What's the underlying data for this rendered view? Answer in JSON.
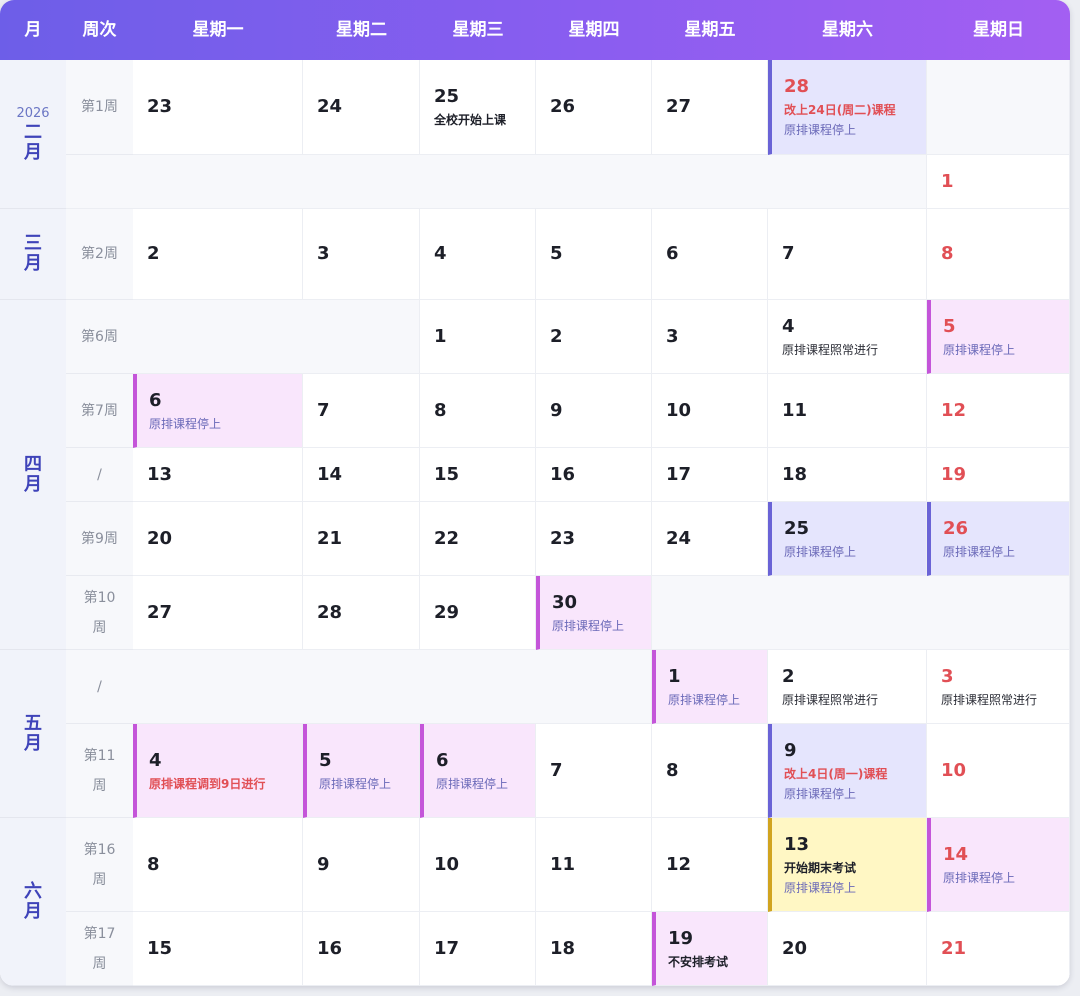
{
  "header": [
    "月",
    "周次",
    "星期一",
    "星期二",
    "星期三",
    "星期四",
    "星期五",
    "星期六",
    "星期日"
  ],
  "months": [
    {
      "name": "二月",
      "year": "2026"
    },
    {
      "name": "三月"
    },
    {
      "name": "四月"
    },
    {
      "name": "五月"
    },
    {
      "name": "六月"
    }
  ],
  "weeks": [
    "第1周",
    "第2周",
    "第6周",
    "第7周",
    "/",
    "第9周",
    "第10周",
    "/",
    "第11周",
    "第16周",
    "第17周"
  ],
  "days": [
    {
      "d": "23"
    },
    {
      "d": "24"
    },
    {
      "d": "25",
      "notes": [
        "全校开始上课"
      ]
    },
    {
      "d": "26"
    },
    {
      "d": "27"
    },
    {
      "d": "28",
      "notes": [
        "改上24日(周二)课程",
        "原排课程停上"
      ]
    },
    {
      "d": "1"
    },
    {
      "d": "2"
    },
    {
      "d": "3"
    },
    {
      "d": "4"
    },
    {
      "d": "5"
    },
    {
      "d": "6"
    },
    {
      "d": "7"
    },
    {
      "d": "8"
    },
    {
      "d": "1"
    },
    {
      "d": "2"
    },
    {
      "d": "3"
    },
    {
      "d": "4",
      "notes": [
        "原排课程照常进行"
      ]
    },
    {
      "d": "5",
      "notes": [
        "原排课程停上"
      ]
    },
    {
      "d": "6",
      "notes": [
        "原排课程停上"
      ]
    },
    {
      "d": "7"
    },
    {
      "d": "8"
    },
    {
      "d": "9"
    },
    {
      "d": "10"
    },
    {
      "d": "11"
    },
    {
      "d": "12"
    },
    {
      "d": "13"
    },
    {
      "d": "14"
    },
    {
      "d": "15"
    },
    {
      "d": "16"
    },
    {
      "d": "17"
    },
    {
      "d": "18"
    },
    {
      "d": "19"
    },
    {
      "d": "20"
    },
    {
      "d": "21"
    },
    {
      "d": "22"
    },
    {
      "d": "23"
    },
    {
      "d": "24"
    },
    {
      "d": "25",
      "notes": [
        "原排课程停上"
      ]
    },
    {
      "d": "26",
      "notes": [
        "原排课程停上"
      ]
    },
    {
      "d": "27"
    },
    {
      "d": "28"
    },
    {
      "d": "29"
    },
    {
      "d": "30",
      "notes": [
        "原排课程停上"
      ]
    },
    {
      "d": "1",
      "notes": [
        "原排课程停上"
      ]
    },
    {
      "d": "2",
      "notes": [
        "原排课程照常进行"
      ]
    },
    {
      "d": "3",
      "notes": [
        "原排课程照常进行"
      ]
    },
    {
      "d": "4",
      "notes": [
        "原排课程调到9日进行"
      ]
    },
    {
      "d": "5",
      "notes": [
        "原排课程停上"
      ]
    },
    {
      "d": "6",
      "notes": [
        "原排课程停上"
      ]
    },
    {
      "d": "7"
    },
    {
      "d": "8"
    },
    {
      "d": "9",
      "notes": [
        "改上4日(周一)课程",
        "原排课程停上"
      ]
    },
    {
      "d": "10"
    },
    {
      "d": "8"
    },
    {
      "d": "9"
    },
    {
      "d": "10"
    },
    {
      "d": "11"
    },
    {
      "d": "12"
    },
    {
      "d": "13",
      "notes": [
        "开始期末考试",
        "原排课程停上"
      ]
    },
    {
      "d": "14",
      "notes": [
        "原排课程停上"
      ]
    },
    {
      "d": "15"
    },
    {
      "d": "16"
    },
    {
      "d": "17"
    },
    {
      "d": "18"
    },
    {
      "d": "19",
      "notes": [
        "不安排考试"
      ]
    },
    {
      "d": "20"
    },
    {
      "d": "21"
    }
  ],
  "colors": {
    "header_start": "#6d5ee8",
    "header_end": "#a35ff2",
    "lavender": "#e5e5fd",
    "lavender_bar": "#6a63d6",
    "pink": "#f9e6fc",
    "pink_bar": "#c455d9",
    "yellow": "#fff7c4",
    "yellow_bar": "#d1a41f",
    "weekend_red": "#e14f55",
    "note_red": "#e14f55",
    "note_gray": "#6a69b8",
    "month": "#3f43b9"
  }
}
